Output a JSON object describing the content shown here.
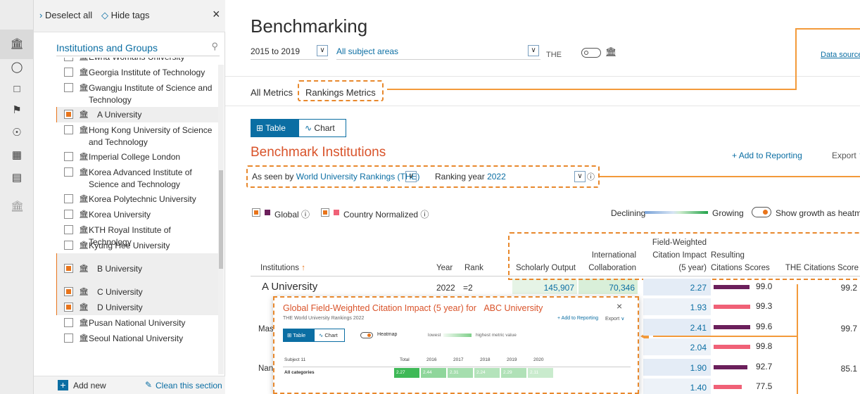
{
  "panel": {
    "deselect_all": "Deselect all",
    "hide_tags": "Hide tags",
    "heading": "Institutions and Groups",
    "items": [
      {
        "name": "Ewha Womans University",
        "checked": false,
        "selected": false
      },
      {
        "name": "Georgia Institute of Technology",
        "checked": false,
        "selected": false
      },
      {
        "name": "Gwangju Institute of Science and Technology",
        "checked": false,
        "selected": false
      },
      {
        "name": "A University",
        "checked": true,
        "selected": true
      },
      {
        "name": "Hong Kong University of Science and Technology",
        "checked": false,
        "selected": false
      },
      {
        "name": "Imperial College London",
        "checked": false,
        "selected": false
      },
      {
        "name": "Korea Advanced Institute of Science and Technology",
        "checked": false,
        "selected": false
      },
      {
        "name": "Korea Polytechnic University",
        "checked": false,
        "selected": false
      },
      {
        "name": "Korea University",
        "checked": false,
        "selected": false
      },
      {
        "name": "KTH Royal Institute of Technology",
        "checked": false,
        "selected": false
      },
      {
        "name": "Kyung Hee University",
        "checked": false,
        "selected": false
      },
      {
        "name": "B University",
        "checked": true,
        "selected": true
      },
      {
        "name": "C University",
        "checked": true,
        "selected": true
      },
      {
        "name": "D University",
        "checked": true,
        "selected": true
      },
      {
        "name": "Pusan National University",
        "checked": false,
        "selected": false
      },
      {
        "name": "Seoul National University",
        "checked": false,
        "selected": false
      }
    ],
    "add_new": "Add new",
    "clean_section": "Clean this section"
  },
  "main": {
    "title": "Benchmarking",
    "year_range": "2015 to 2019",
    "subject": "All subject areas",
    "source": "THE",
    "data_sources": "Data sources",
    "tabs": [
      "All Metrics",
      "Rankings Metrics"
    ],
    "view_table": "Table",
    "view_chart": "Chart",
    "section_title": "Benchmark Institutions",
    "add_to_reporting": "Add to Reporting",
    "export": "Export",
    "as_seen_by_prefix": "As seen by",
    "as_seen_by_value": "World University Rankings (THE)",
    "ranking_year_label": "Ranking year",
    "ranking_year_value": "2022",
    "legend_global": "Global",
    "legend_country": "Country Normalized",
    "declining": "Declining",
    "growing": "Growing",
    "heatmap_toggle": "Show growth as heatmap",
    "columns": {
      "institutions": "Institutions",
      "year": "Year",
      "rank": "Rank",
      "scholarly_output": "Scholarly Output",
      "intl_collab_1": "International",
      "intl_collab_2": "Collaboration",
      "fwci_1": "Field-Weighted",
      "fwci_2": "Citation Impact",
      "fwci_3": "(5 year)",
      "resulting_1": "Resulting",
      "resulting_2": "Citations Scores",
      "the_citations": "THE Citations Score"
    },
    "rows": [
      {
        "institution": "A University",
        "year": "2022",
        "rank": "=2",
        "scholarly_output": "145,907",
        "intl_collab": "70,346",
        "fwci": [
          "2.27",
          "1.93"
        ],
        "scores": [
          {
            "value": "99.0",
            "frac": 0.99,
            "type": "global"
          },
          {
            "value": "99.3",
            "frac": 0.993,
            "type": "country"
          }
        ],
        "the_score": "99.2"
      },
      {
        "institution": "Mas",
        "fwci": [
          "2.41",
          "2.04"
        ],
        "scores": [
          {
            "value": "99.6",
            "frac": 0.996,
            "type": "global"
          },
          {
            "value": "99.8",
            "frac": 0.998,
            "type": "country"
          }
        ],
        "the_score": "99.7"
      },
      {
        "institution": "Nan",
        "fwci": [
          "1.90",
          "1.40"
        ],
        "scores": [
          {
            "value": "92.7",
            "frac": 0.927,
            "type": "global"
          },
          {
            "value": "77.5",
            "frac": 0.775,
            "type": "country"
          }
        ],
        "the_score": "85.1"
      }
    ]
  },
  "popup": {
    "title_prefix": "Global Field-Weighted Citation Impact (5 year) for",
    "title_inst": "ABC University",
    "subtitle": "THE World University Rankings 2022",
    "add_to_reporting": "Add to Reporting",
    "export": "Export",
    "view_table": "Table",
    "view_chart": "Chart",
    "heatmap": "Heatmap",
    "lowest": "lowest",
    "highest": "highest metric value",
    "headers": [
      "Subject 11",
      "Total",
      "2016",
      "2017",
      "2018",
      "2019",
      "2020"
    ],
    "row_label": "All categories",
    "row_values": [
      "2.27",
      "2.44",
      "2.31",
      "2.24",
      "2.29",
      "2.11"
    ]
  },
  "colors": {
    "accent_orange": "#e8741b",
    "link_blue": "#0b6ea3",
    "global_bar": "#6b1f5b",
    "country_bar": "#f06177",
    "title_orange": "#d9532a"
  }
}
